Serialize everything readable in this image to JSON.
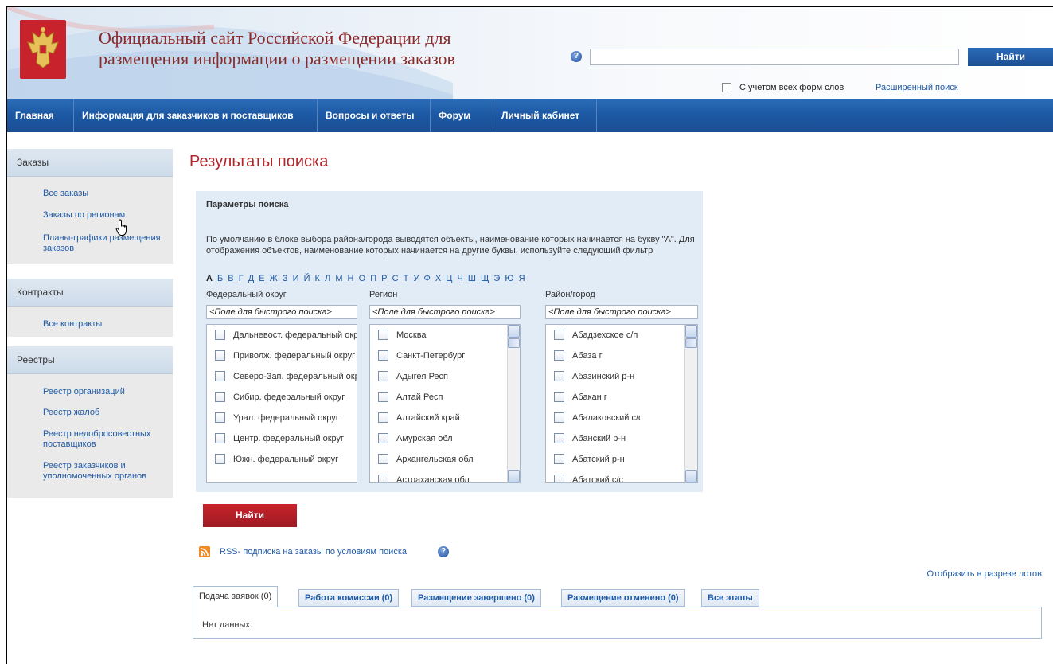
{
  "header": {
    "site_title_line1": "Официальный сайт Российской Федерации для",
    "site_title_line2": "размещения информации о размещении заказов",
    "search_value": "",
    "find_label": "Найти",
    "morph_label": "С учетом всех форм слов",
    "advanced_search_label": "Расширенный поиск"
  },
  "nav": {
    "items": [
      {
        "label": "Главная"
      },
      {
        "label": "Информация для заказчиков и поставщиков"
      },
      {
        "label": "Вопросы и ответы"
      },
      {
        "label": "Форум"
      },
      {
        "label": "Личный кабинет"
      }
    ]
  },
  "sidebar": {
    "sections": [
      {
        "title": "Заказы",
        "links": [
          "Все заказы",
          "Заказы по регионам",
          "Планы-графики размещения заказов"
        ]
      },
      {
        "title": "Контракты",
        "links": [
          "Все контракты"
        ]
      },
      {
        "title": "Реестры",
        "links": [
          "Реестр организаций",
          "Реестр жалоб",
          "Реестр недобросовестных поставщиков",
          "Реестр заказчиков и уполномоченных органов"
        ]
      }
    ]
  },
  "main": {
    "page_title": "Результаты поиска",
    "params": {
      "title": "Параметры поиска",
      "description": "По умолчанию в блоке выбора района/города выводятся объекты, наименование которых начинается на букву \"А\". Для отображения объектов, наименование которых начинается на другие буквы, используйте следующий фильтр",
      "alphabet": [
        "А",
        "Б",
        "В",
        "Г",
        "Д",
        "Е",
        "Ж",
        "З",
        "И",
        "Й",
        "К",
        "Л",
        "М",
        "Н",
        "О",
        "П",
        "Р",
        "С",
        "Т",
        "У",
        "Ф",
        "Х",
        "Ц",
        "Ч",
        "Ш",
        "Щ",
        "Э",
        "Ю",
        "Я"
      ],
      "active_letter": "А",
      "quick_search_placeholder": "<Поле для быстрого поиска>",
      "columns": [
        {
          "label": "Федеральный округ",
          "items": [
            "Дальневост. федеральный округ",
            "Приволж. федеральный округ",
            "Северо-Зап. федеральный округ",
            "Сибир. федеральный округ",
            "Урал. федеральный округ",
            "Центр. федеральный округ",
            "Южн. федеральный округ"
          ]
        },
        {
          "label": "Регион",
          "items": [
            "Москва",
            "Санкт-Петербург",
            "Адыгея Респ",
            "Алтай Респ",
            "Алтайский край",
            "Амурская обл",
            "Архангельская обл",
            "Астраханская обл"
          ]
        },
        {
          "label": "Район/город",
          "items": [
            "Абадзехское с/п",
            "Абаза г",
            "Абазинский р-н",
            "Абакан г",
            "Абалаковский с/с",
            "Абанский р-н",
            "Абатский р-н",
            "Абатский с/с"
          ]
        }
      ]
    },
    "find_label": "Найти",
    "rss_label": "RSS- подписка на заказы по условиям поиска",
    "lots_label": "Отобразить в разрезе лотов",
    "tabs": [
      {
        "label": "Подача заявок (0)",
        "active": true
      },
      {
        "label": "Работа комиссии (0)",
        "active": false
      },
      {
        "label": "Размещение завершено (0)",
        "active": false
      },
      {
        "label": "Размещение отменено (0)",
        "active": false
      },
      {
        "label": "Все этапы",
        "active": false
      }
    ],
    "no_data": "Нет данных."
  },
  "colors": {
    "nav_blue": "#1c58a3",
    "title_red": "#b3252c",
    "link_blue": "#1f5aa6",
    "params_bg": "#e2ecf7"
  }
}
